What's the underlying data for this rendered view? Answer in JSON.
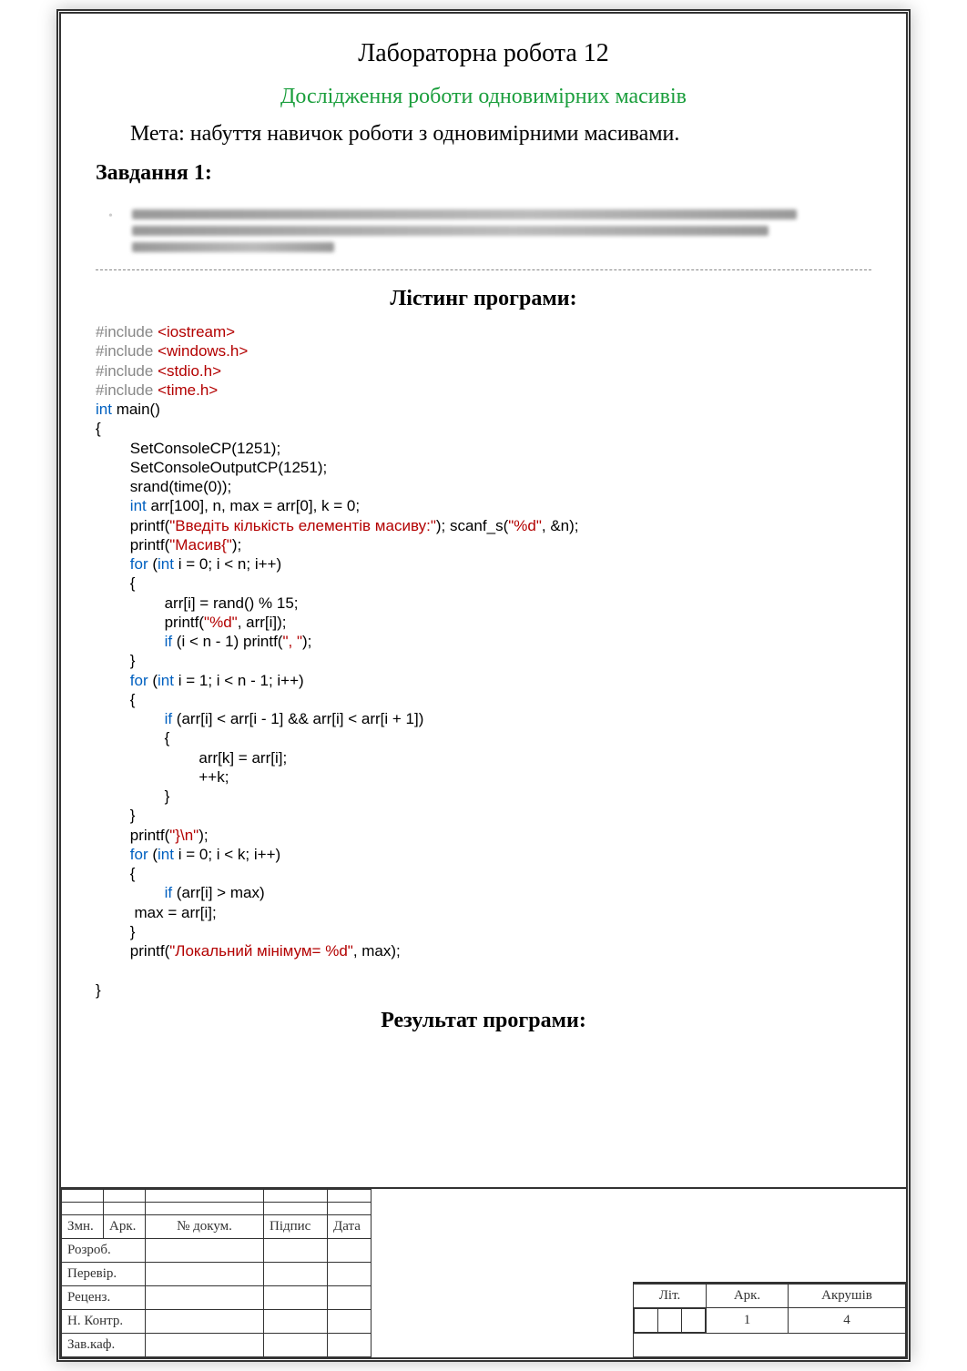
{
  "title": "Лабораторна робота 12",
  "subtitle": "Дослідження роботи одновимірних масивів",
  "goal": "Мета: набуття навичок роботи з одновимірними масивами.",
  "task_label": "Завдання 1:",
  "listing_head": "Лістинг програми:",
  "result_head": "Результат програми:",
  "code": {
    "inc": "#include ",
    "io": "<iostream>",
    "win": "<windows.h>",
    "stdio": "<stdio.h>",
    "time": "<time.h>",
    "int": "int",
    "main": " main()",
    "ob": "{",
    "cb": "}",
    "s1": "SetConsoleCP(1251);",
    "s2": "SetConsoleOutputCP(1251);",
    "s3": "srand(time(0));",
    "decl": " arr[100], n, max = arr[0], k = 0;",
    "p1a": "printf(",
    "p1s": "\"Введіть кількість елементів масиву:\"",
    "p1b": "); scanf_s(",
    "p1f": "\"%d\"",
    "p1c": ", &n);",
    "p2s": "\"Масив{\"",
    "p2c": ");",
    "for": "for",
    "for1": " i = 0; i < n; i++)",
    "a1": "arr[i] = rand() % 15;",
    "a2a": "printf(",
    "a2s": "\"%d\"",
    "a2b": ", arr[i]);",
    "if": "if",
    "if1": " (i < n - 1) printf(",
    "if1s": "\", \"",
    "if1b": ");",
    "for2": " i = 1; i < n - 1; i++)",
    "if2": " (arr[i] < arr[i - 1] && arr[i] < arr[i + 1])",
    "b1": "arr[k] = arr[i];",
    "b2": "++k;",
    "p3a": "printf(",
    "p3s": "\"}\\n\"",
    "p3b": ");",
    "for3": " i = 0; i < k; i++)",
    "if3": " (arr[i] > max)",
    "mx": " max = arr[i];",
    "p4a": "printf(",
    "p4s": "\"Локальний мінімум= %d\"",
    "p4b": ", max);",
    "lpar": " (",
    "rpar": ")"
  },
  "stamp": {
    "col1": "Змн.",
    "col2": "Арк.",
    "col3": "№ докум.",
    "col4": "Підпис",
    "col5": "Дата",
    "r1": "Розроб.",
    "r2": "Перевір.",
    "r3": "Реценз.",
    "r4": "Н. Контр.",
    "r5": "Зав.каф.",
    "lit": "Літ.",
    "ark": "Арк.",
    "arksh": "Акрушів",
    "page": "1",
    "pages": "4"
  }
}
